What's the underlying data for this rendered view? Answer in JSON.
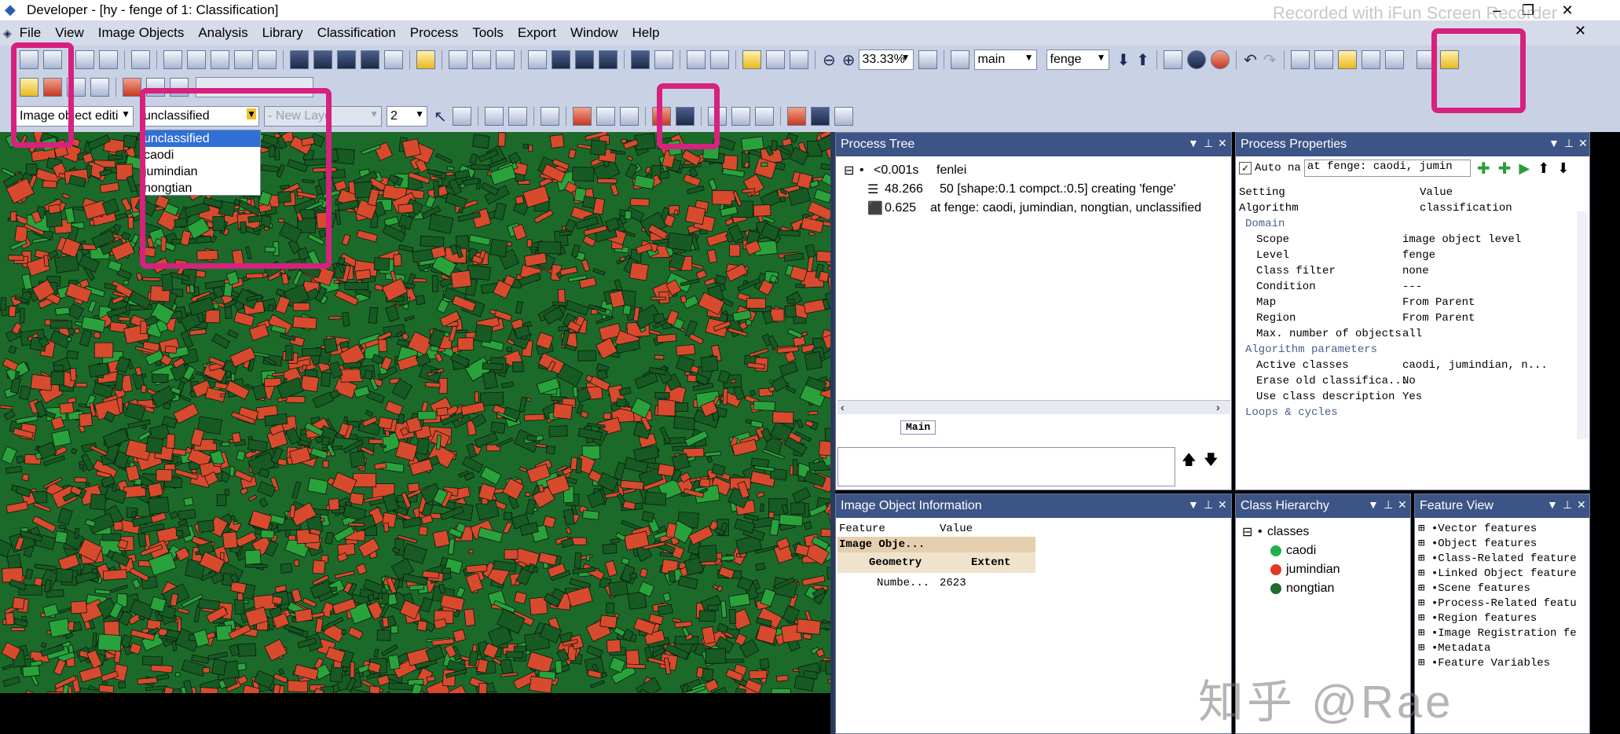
{
  "window": {
    "title": "Developer - [hy - fenge of 1: Classification]",
    "recorder_watermark": "Recorded with iFun Screen Recorder",
    "controls": [
      "–",
      "❐",
      "✕"
    ]
  },
  "menu": [
    "File",
    "View",
    "Image Objects",
    "Analysis",
    "Library",
    "Classification",
    "Process",
    "Tools",
    "Export",
    "Window",
    "Help"
  ],
  "toolbar": {
    "zoom": "33.33%",
    "map_select": "main",
    "level_select": "fenge",
    "editing_mode": "Image object editi",
    "class_select": "unclassified",
    "new_layer": "- New Laye",
    "brush_size": "2"
  },
  "class_dropdown": {
    "options": [
      "unclassified",
      "caodi",
      "jumindian",
      "nongtian"
    ],
    "selected": "unclassified"
  },
  "process_tree": {
    "title": "Process Tree",
    "items": [
      {
        "time": "<0.001s",
        "label": "fenlei"
      },
      {
        "time": "48.266",
        "label": "50 [shape:0.1 compct.:0.5] creating 'fenge'"
      },
      {
        "time": "0.625",
        "label": "at  fenge: caodi, jumindian, nongtian, unclassified"
      }
    ],
    "tab": "Main"
  },
  "process_properties": {
    "title": "Process Properties",
    "auto_name_label": "Auto na",
    "auto_name_value": "at  fenge: caodi, jumin",
    "col_setting": "Setting",
    "col_value": "Value",
    "algorithm_key": "Algorithm",
    "algorithm_value": "classification",
    "rows": [
      {
        "type": "section",
        "key": "Domain",
        "value": ""
      },
      {
        "type": "row",
        "key": "Scope",
        "value": "image object level"
      },
      {
        "type": "row",
        "key": "Level",
        "value": "fenge"
      },
      {
        "type": "row",
        "key": "Class filter",
        "value": "none"
      },
      {
        "type": "row",
        "key": "Condition",
        "value": "---"
      },
      {
        "type": "row",
        "key": "Map",
        "value": "From Parent"
      },
      {
        "type": "row",
        "key": "Region",
        "value": "From Parent"
      },
      {
        "type": "row",
        "key": "Max. number of objects",
        "value": "all"
      },
      {
        "type": "section",
        "key": "Algorithm parameters",
        "value": ""
      },
      {
        "type": "row",
        "key": "Active classes",
        "value": "caodi, jumindian, n..."
      },
      {
        "type": "row",
        "key": "Erase old classifica...",
        "value": "No"
      },
      {
        "type": "row",
        "key": "Use class description",
        "value": "Yes"
      },
      {
        "type": "section",
        "key": "Loops & cycles",
        "value": ""
      }
    ]
  },
  "image_object_info": {
    "title": "Image Object Information",
    "col_feature": "Feature",
    "col_value": "Value",
    "group": "Image Obje...",
    "sub_a": "Geometry",
    "sub_b": "Extent",
    "number_label": "Numbe...",
    "number_value": "2623"
  },
  "class_hierarchy": {
    "title": "Class Hierarchy",
    "root": "classes",
    "classes": [
      {
        "name": "caodi",
        "color": "#22b04a"
      },
      {
        "name": "jumindian",
        "color": "#e03a22"
      },
      {
        "name": "nongtian",
        "color": "#1e6b2c"
      }
    ]
  },
  "feature_view": {
    "title": "Feature View",
    "items": [
      "Vector features",
      "Object features",
      "Class-Related feature",
      "Linked Object feature",
      "Scene features",
      "Process-Related featu",
      "Region features",
      "Image Registration fe",
      "Metadata",
      "Feature Variables"
    ]
  },
  "watermark": "知乎 @Rae",
  "colors": {
    "highlight": "#d6217e",
    "panel_header": "#3d5586",
    "map_green": "#1c6a2a",
    "map_red": "#d84a2e"
  }
}
